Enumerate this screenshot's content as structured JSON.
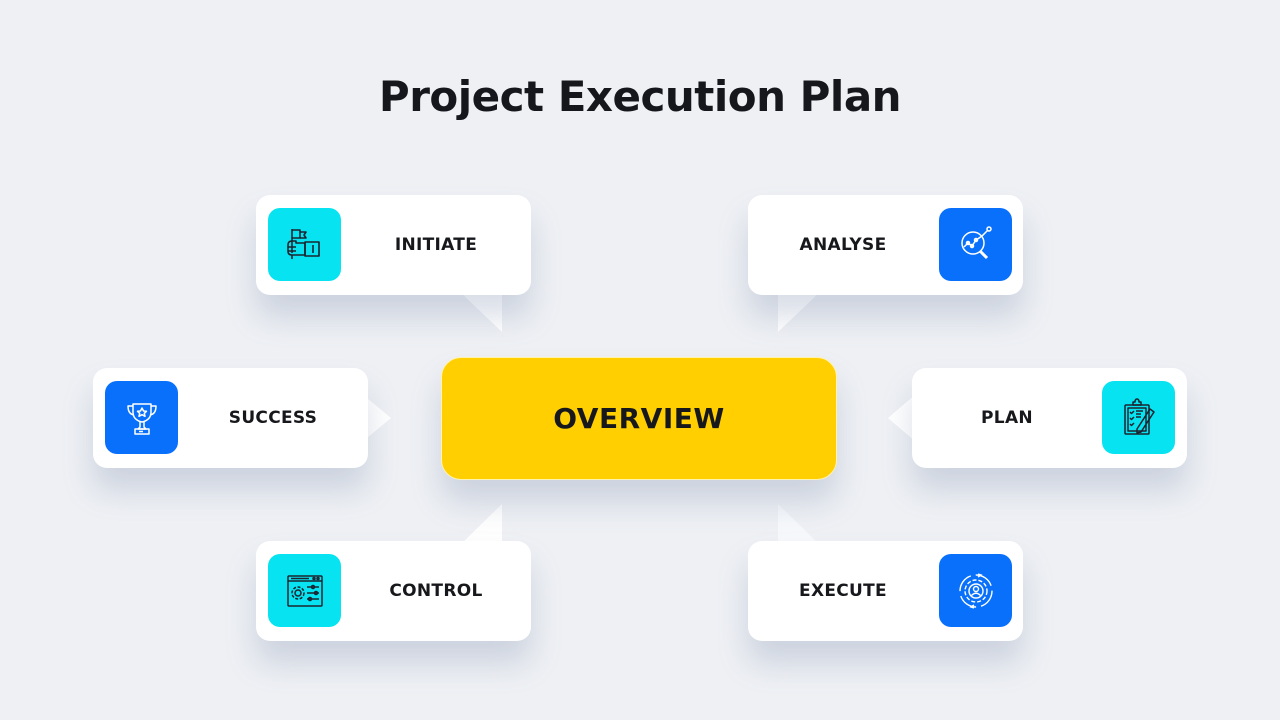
{
  "title": "Project Execution Plan",
  "center": {
    "label": "OVERVIEW",
    "color": "#ffcf02"
  },
  "colors": {
    "cyan": "#07e3f0",
    "blue": "#0870fb",
    "background": "#eef0f4"
  },
  "nodes": [
    {
      "id": "initiate",
      "label": "INITIATE",
      "icon": "flag-hand-icon",
      "icon_color": "cyan"
    },
    {
      "id": "analyse",
      "label": "ANALYSE",
      "icon": "magnifier-chart-icon",
      "icon_color": "blue"
    },
    {
      "id": "success",
      "label": "SUCCESS",
      "icon": "trophy-icon",
      "icon_color": "blue"
    },
    {
      "id": "plan",
      "label": "PLAN",
      "icon": "clipboard-pencil-icon",
      "icon_color": "cyan"
    },
    {
      "id": "control",
      "label": "CONTROL",
      "icon": "settings-panel-icon",
      "icon_color": "cyan"
    },
    {
      "id": "execute",
      "label": "EXECUTE",
      "icon": "gear-user-icon",
      "icon_color": "blue"
    }
  ]
}
